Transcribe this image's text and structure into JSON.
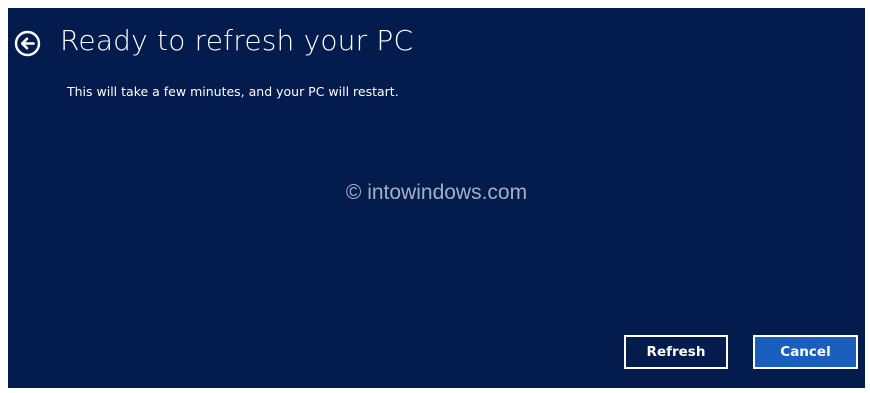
{
  "dialog": {
    "title": "Ready to refresh your PC",
    "subtitle": "This will take a few minutes, and your PC will restart.",
    "watermark": "© intowindows.com",
    "back_icon": "back-arrow-circle-icon"
  },
  "buttons": {
    "refresh_label": "Refresh",
    "cancel_label": "Cancel"
  },
  "colors": {
    "background": "#031c4d",
    "accent": "#1a5fbe",
    "text": "#ffffff"
  }
}
